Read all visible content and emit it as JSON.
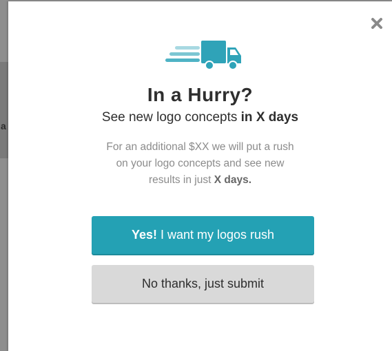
{
  "backdrop": {
    "partial_letter": "a"
  },
  "modal": {
    "close_icon": "close-icon",
    "truck_icon": "delivery-truck-icon",
    "title": "In a Hurry?",
    "subtitle_prefix": "See new logo concepts ",
    "subtitle_bold": "in X days",
    "desc_line1": "For an additional $XX we will put a rush",
    "desc_line2": "on your logo concepts and see new",
    "desc_line3_prefix": "results in just ",
    "desc_line3_bold": "X days.",
    "primary_button_bold": "Yes!",
    "primary_button_rest": " I want my logos rush",
    "secondary_button": "No thanks, just submit"
  },
  "colors": {
    "accent": "#24a1b4",
    "accent_icon": "#2fa3b8",
    "secondary_button_bg": "#d9d9d9",
    "text_dark": "#2e2e2e",
    "text_muted": "#8b8b8b"
  }
}
